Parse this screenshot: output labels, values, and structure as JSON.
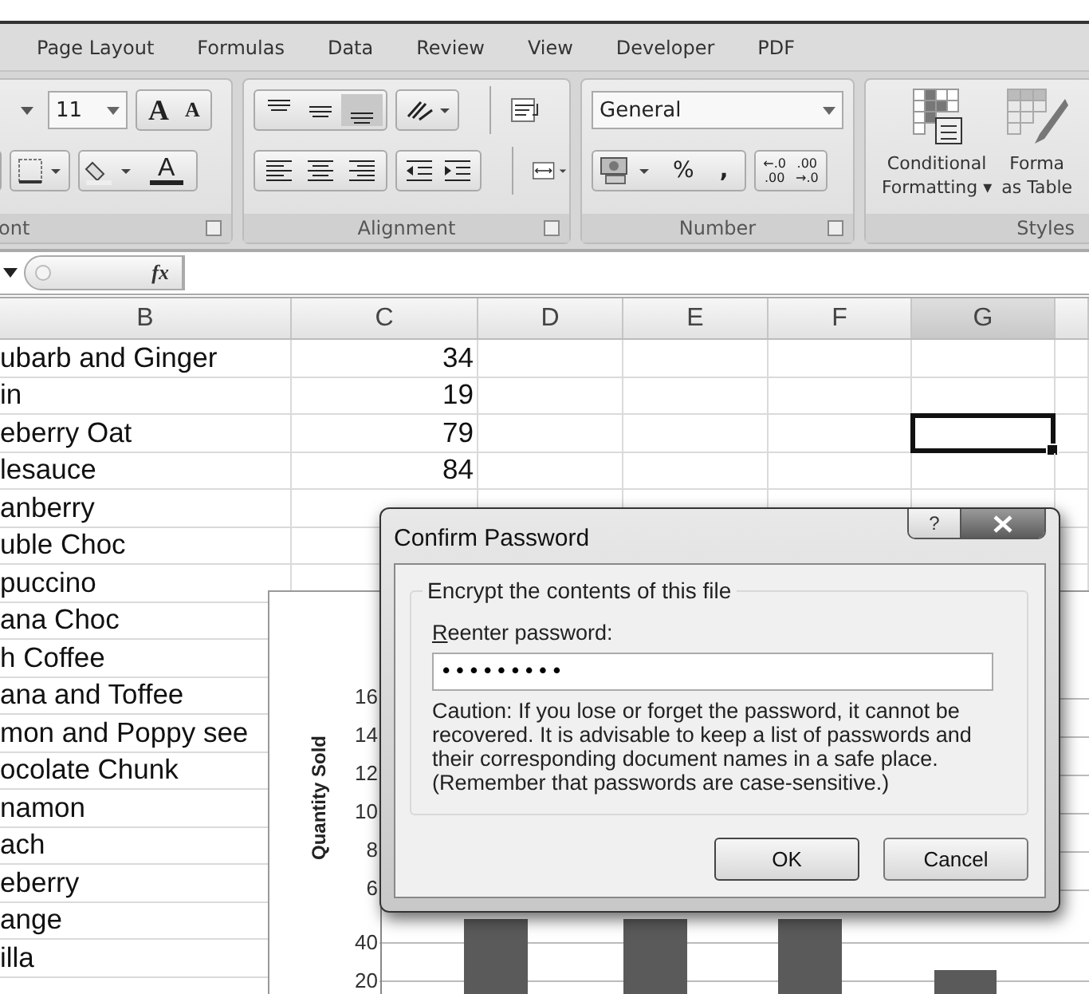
{
  "ribbon": {
    "tabs": [
      {
        "label": "Page Layout",
        "selected": false
      },
      {
        "label": "Formulas",
        "selected": false
      },
      {
        "label": "Data",
        "selected": false
      },
      {
        "label": "Review",
        "selected": false
      },
      {
        "label": "View",
        "selected": false
      },
      {
        "label": "Developer",
        "selected": false
      },
      {
        "label": "PDF",
        "selected": false
      }
    ],
    "font_group": {
      "label": "ont",
      "font_size": "11",
      "grow_font": "A",
      "shrink_font": "A",
      "font_color": "A"
    },
    "alignment_group": {
      "label": "Alignment"
    },
    "number_group": {
      "label": "Number",
      "format": "General",
      "percent": "%",
      "comma": ",",
      "increase_decimal": [
        "←.0",
        ".00"
      ],
      "decrease_decimal": [
        ".00",
        "→.0"
      ]
    },
    "styles_group": {
      "label": "Styles",
      "buttons": [
        {
          "kind": "conditional",
          "lines": [
            "Conditional",
            "Formatting ▾"
          ]
        },
        {
          "kind": "table",
          "lines": [
            "Forma",
            "as Table"
          ]
        }
      ]
    }
  },
  "formula_bar": {
    "fx": "fx"
  },
  "sheet": {
    "columns": [
      {
        "label": "B",
        "selected": false
      },
      {
        "label": "C",
        "selected": false
      },
      {
        "label": "D",
        "selected": false
      },
      {
        "label": "E",
        "selected": false
      },
      {
        "label": "F",
        "selected": false
      },
      {
        "label": "G",
        "selected": true
      }
    ],
    "rows": [
      {
        "cells": [
          "ubarb and Ginger",
          "34"
        ],
        "selected": false
      },
      {
        "cells": [
          "in",
          "19"
        ],
        "selected": false
      },
      {
        "cells": [
          "eberry Oat",
          "79"
        ],
        "selected": true
      },
      {
        "cells": [
          "lesauce",
          "84"
        ],
        "selected": false
      },
      {
        "cells": [
          "anberry"
        ],
        "selected": false
      },
      {
        "cells": [
          "uble Choc"
        ],
        "selected": false
      },
      {
        "cells": [
          "puccino"
        ],
        "selected": false
      },
      {
        "cells": [
          "ana Choc"
        ],
        "selected": false
      },
      {
        "cells": [
          "h Coffee"
        ],
        "selected": false
      },
      {
        "cells": [
          "ana and Toffee"
        ],
        "selected": false
      },
      {
        "cells": [
          "mon and Poppy see"
        ],
        "selected": false
      },
      {
        "cells": [
          "ocolate Chunk"
        ],
        "selected": false
      },
      {
        "cells": [
          "namon"
        ],
        "selected": false
      },
      {
        "cells": [
          "ach"
        ],
        "selected": false
      },
      {
        "cells": [
          "eberry"
        ],
        "selected": false
      },
      {
        "cells": [
          "ange"
        ],
        "selected": false
      },
      {
        "cells": [
          "illa"
        ],
        "selected": false
      }
    ]
  },
  "chart": {
    "y_axis_title": "Quantity Sold",
    "y_ticks": [
      "16",
      "14",
      "12",
      "10",
      "8",
      "6",
      "40",
      "20"
    ]
  },
  "dialog": {
    "title": "Confirm Password",
    "help": "?",
    "group_title": "Encrypt the contents of this file",
    "field_label": "Reenter password:",
    "field_value": "•••••••••",
    "caution": "Caution: If you lose or forget the password, it cannot be recovered. It is advisable to keep a list of passwords and their corresponding document names in a safe place. (Remember that passwords are case-sensitive.)",
    "buttons": [
      "OK",
      "Cancel"
    ]
  }
}
